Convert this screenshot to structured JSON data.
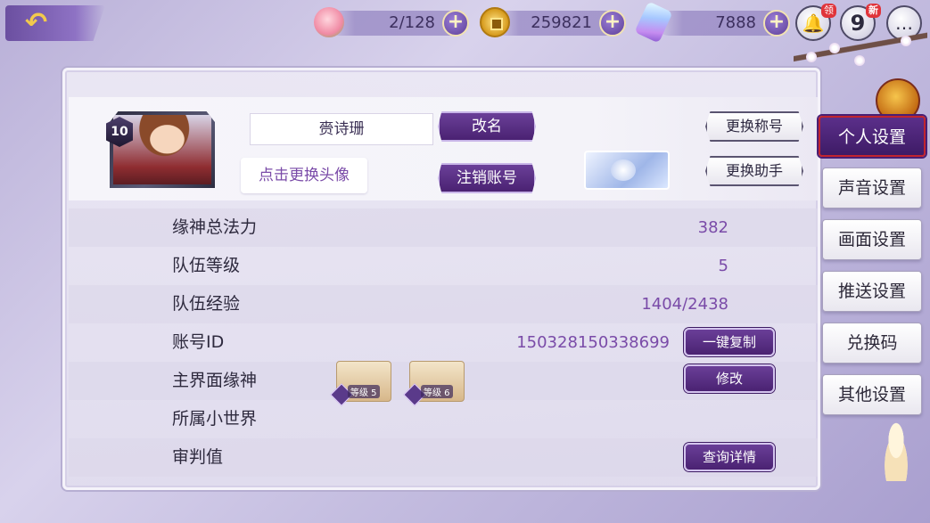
{
  "topbar": {
    "peach": {
      "value": "2/128",
      "plus": "+"
    },
    "coins": {
      "value": "259821",
      "plus": "+"
    },
    "crystal": {
      "value": "7888",
      "plus": "+"
    },
    "gift_badge": "领",
    "nine_badge": "新",
    "nine_label": "9",
    "chat_label": "…"
  },
  "profile": {
    "level": "10",
    "name": "赍诗珊",
    "rename_button": "改名",
    "change_avatar": "点击更换头像",
    "cancel_account_button": "注销账号",
    "change_title_button": "更换称号",
    "change_helper_button": "更换助手"
  },
  "info": [
    {
      "label": "缘神总法力",
      "value": "382"
    },
    {
      "label": "队伍等级",
      "value": "5"
    },
    {
      "label": "队伍经验",
      "value": "1404/2438"
    },
    {
      "label": "账号ID",
      "value": "150328150338699",
      "button": "一键复制"
    },
    {
      "label": "主界面缘神",
      "value": "",
      "button": "修改",
      "chars": [
        {
          "lv": "等级 5"
        },
        {
          "lv": "等级 6"
        }
      ]
    },
    {
      "label": "所属小世界",
      "value": ""
    },
    {
      "label": "审判值",
      "value": "",
      "button": "查询详情"
    }
  ],
  "tabs": [
    {
      "label": "个人设置",
      "active": true
    },
    {
      "label": "声音设置",
      "active": false
    },
    {
      "label": "画面设置",
      "active": false
    },
    {
      "label": "推送设置",
      "active": false
    },
    {
      "label": "兑换码",
      "active": false
    },
    {
      "label": "其他设置",
      "active": false
    }
  ],
  "colors": {
    "accent": "#7a4ba8",
    "button": "#4a2272",
    "active_tab_border": "#c1242e"
  }
}
